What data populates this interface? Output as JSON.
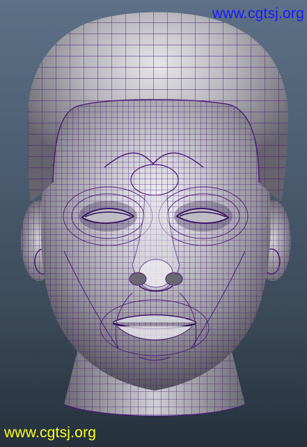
{
  "scene": {
    "subject": "wireframe-head",
    "wire_color": "#4b1a7a",
    "background_top": "#5d7087",
    "background_bottom": "#25303c",
    "skin_light": "#eeeef2",
    "skin_dark": "#4a4a52"
  },
  "watermarks": {
    "top_right": "www.cgtsj.org",
    "top_right_color": "#1a1aff",
    "bottom_left": "www.cgtsj.org",
    "bottom_left_color": "#ffff1a"
  }
}
